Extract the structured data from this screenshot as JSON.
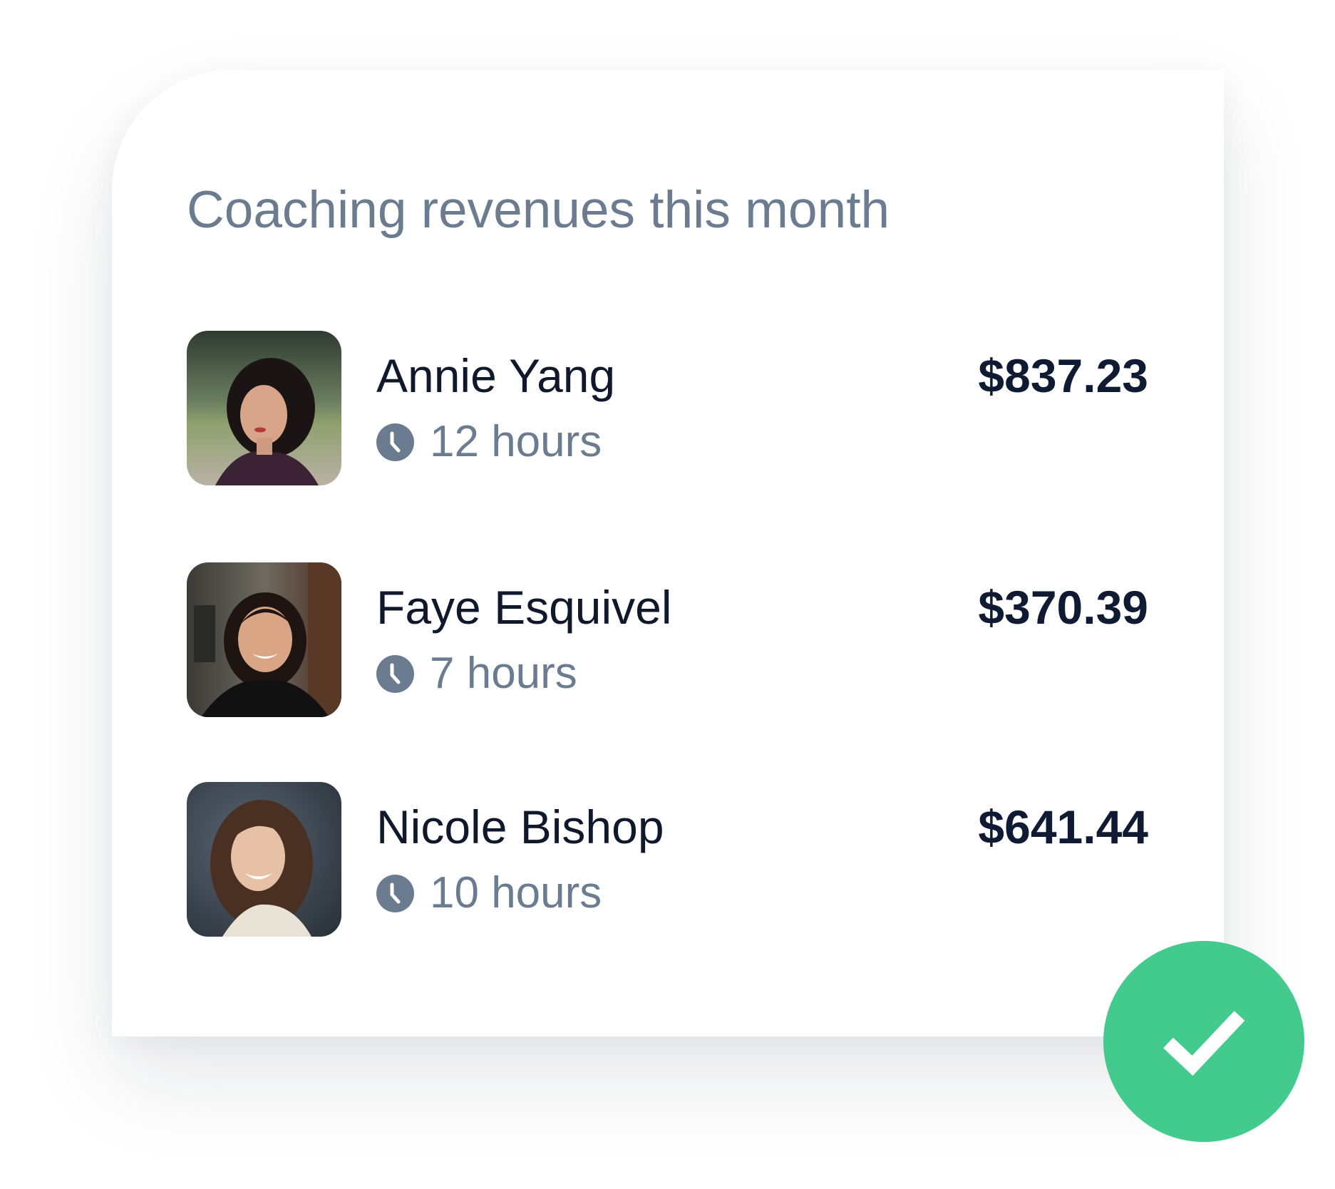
{
  "card": {
    "title": "Coaching revenues this month"
  },
  "coaches": [
    {
      "name": "Annie Yang",
      "hours": "12 hours",
      "amount": "$837.23",
      "avatar_icon": "person-photo"
    },
    {
      "name": "Faye Esquivel",
      "hours": "7 hours",
      "amount": "$370.39",
      "avatar_icon": "person-photo"
    },
    {
      "name": "Nicole Bishop",
      "hours": "10 hours",
      "amount": "$641.44",
      "avatar_icon": "person-photo"
    }
  ],
  "icons": {
    "hours": "clock-icon",
    "badge": "checkmark-icon"
  },
  "colors": {
    "accent_green": "#42cb8d",
    "name_text": "#10182b",
    "muted_text": "#6b7b90",
    "amount_text": "#0f1a33",
    "clock_fill": "#6b7b90"
  }
}
